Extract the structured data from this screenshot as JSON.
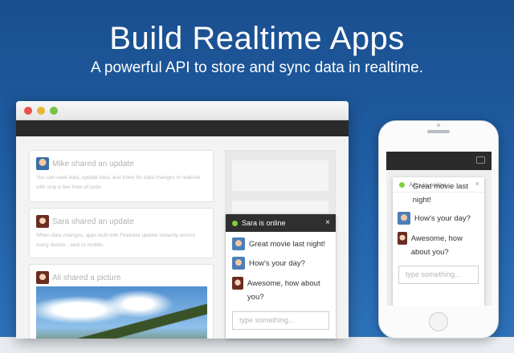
{
  "hero": {
    "headline": "Build Realtime Apps",
    "subhead": "A powerful API to store and sync data in realtime."
  },
  "desktop": {
    "feed": [
      {
        "title": "Mike shared an update",
        "text": "You can save data, update data, and listen for data changes in realtime with only a few lines of code.",
        "avatar_icon": "avatar-mike"
      },
      {
        "title": "Sara shared an update",
        "text": "When data changes, apps built with Firebase update instantly across every device - web or mobile.",
        "avatar_icon": "avatar-sara"
      },
      {
        "title": "Ali shared a picture",
        "avatar_icon": "avatar-ali"
      }
    ],
    "chat": {
      "status": "Sara is online",
      "close": "×",
      "messages": [
        {
          "text": "Great movie last night!",
          "avatar_icon": "avatar-alex"
        },
        {
          "text": "How's your day?",
          "avatar_icon": "avatar-alex"
        },
        {
          "text": "Awesome, how about you?",
          "avatar_icon": "avatar-sara"
        }
      ],
      "input_placeholder": "type something..."
    }
  },
  "phone": {
    "chat": {
      "status": "Alex is online",
      "close": "×",
      "messages": [
        {
          "text": "Great movie last night!"
        },
        {
          "text": "How's your day?"
        },
        {
          "text": "Awesome, how about you?"
        }
      ],
      "input_placeholder": "type something..."
    }
  },
  "colors": {
    "background": "#1f5da3",
    "online": "#7ed23a",
    "chat_header": "#2f2f2f"
  }
}
